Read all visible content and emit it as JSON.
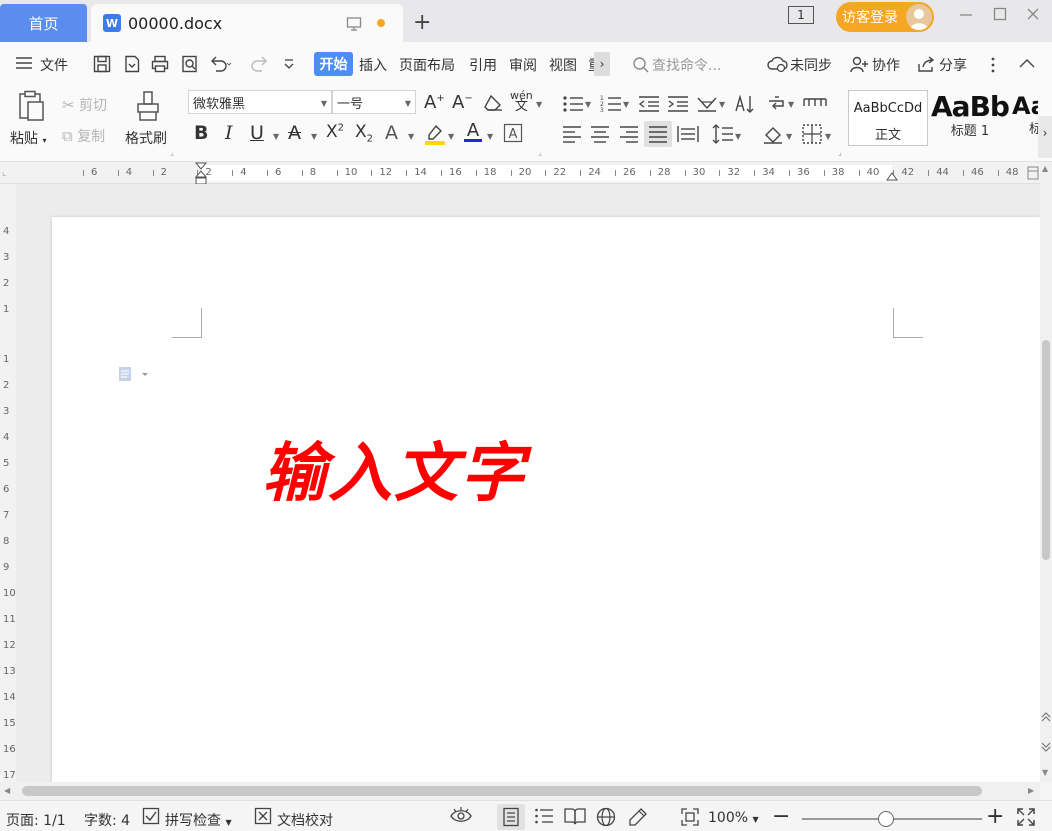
{
  "tabs": {
    "home": "首页",
    "doc": "00000.docx"
  },
  "titlebar": {
    "window_count": "1",
    "login": "访客登录"
  },
  "menu": {
    "file": "文件",
    "start": "开始",
    "insert": "插入",
    "layout": "页面布局",
    "ref": "引用",
    "review": "审阅",
    "view": "视图",
    "more_cut": "重",
    "search": "查找命令...",
    "sync": "未同步",
    "collab": "协作",
    "share": "分享"
  },
  "ribbon": {
    "paste": "粘贴",
    "cut": "剪切",
    "copy": "复制",
    "format_painter": "格式刷",
    "font_name": "微软雅黑",
    "font_size": "一号",
    "styles": [
      {
        "preview": "AaBbCcDd",
        "label": "正文"
      },
      {
        "preview": "AaBb",
        "label": "标题 1"
      },
      {
        "preview": "Aa",
        "label": "标"
      }
    ]
  },
  "ruler": {
    "h_ticks": [
      "6",
      "4",
      "2",
      "2",
      "4",
      "6",
      "8",
      "10",
      "12",
      "14",
      "16",
      "18",
      "20",
      "22",
      "24",
      "26",
      "28",
      "30",
      "32",
      "34",
      "36",
      "38",
      "40",
      "42",
      "44",
      "46",
      "48"
    ],
    "v_ticks": [
      "4",
      "3",
      "2",
      "1",
      "1",
      "2",
      "3",
      "4",
      "5",
      "6",
      "7",
      "8",
      "9",
      "10",
      "11",
      "12",
      "13",
      "14",
      "15",
      "16",
      "17"
    ]
  },
  "document": {
    "text": "输入文字",
    "text_color": "#ff0000"
  },
  "status": {
    "page": "页面: 1/1",
    "words": "字数: 4",
    "spell": "拼写检查",
    "proof": "文档校对",
    "zoom": "100%"
  },
  "colors": {
    "accent": "#4c8df6",
    "login": "#f5a623",
    "highlight": "#ffd700",
    "font_color": "#ff0000"
  }
}
